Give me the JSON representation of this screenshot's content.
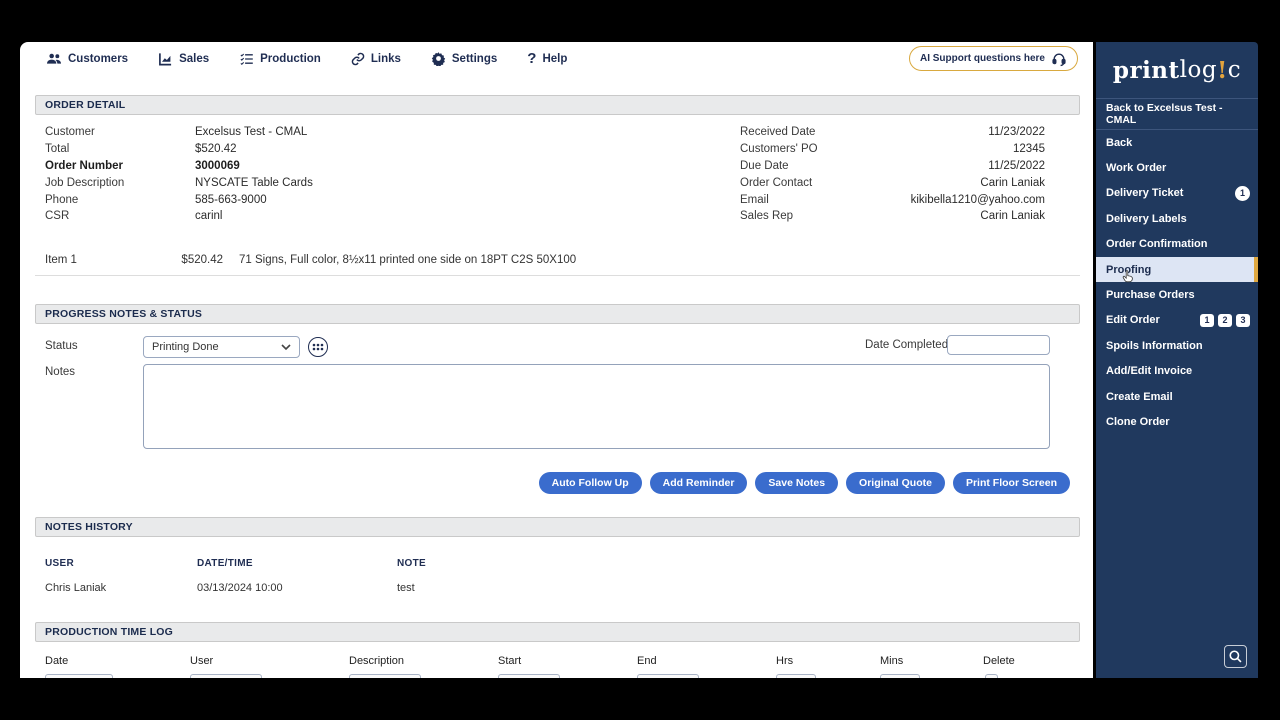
{
  "nav": {
    "items": [
      {
        "label": "Customers",
        "icon": "customers-icon"
      },
      {
        "label": "Sales",
        "icon": "sales-icon"
      },
      {
        "label": "Production",
        "icon": "production-icon"
      },
      {
        "label": "Links",
        "icon": "links-icon"
      },
      {
        "label": "Settings",
        "icon": "settings-icon"
      },
      {
        "label": "Help",
        "icon": "help-icon"
      }
    ],
    "ai_support_label": "AI Support questions here"
  },
  "order_detail": {
    "title": "ORDER DETAIL",
    "left": [
      {
        "label": "Customer",
        "value": "Excelsus Test - CMAL"
      },
      {
        "label": "Total",
        "value": "$520.42"
      },
      {
        "label": "Order Number",
        "value": "3000069"
      },
      {
        "label": "Job Description",
        "value": "NYSCATE Table Cards"
      },
      {
        "label": "Phone",
        "value": "585-663-9000"
      },
      {
        "label": "CSR",
        "value": "carinl"
      }
    ],
    "right": [
      {
        "label": "Received Date",
        "value": "11/23/2022"
      },
      {
        "label": "Customers' PO",
        "value": "12345"
      },
      {
        "label": "Due Date",
        "value": "11/25/2022"
      },
      {
        "label": "Order Contact",
        "value": "Carin Laniak"
      },
      {
        "label": "Email",
        "value": "kikibella1210@yahoo.com"
      },
      {
        "label": "Sales Rep",
        "value": "Carin Laniak"
      }
    ],
    "item": {
      "name": "Item 1",
      "price": "$520.42",
      "description": "71 Signs, Full color, 8½x11 printed one side on 18PT C2S 50X100"
    }
  },
  "progress": {
    "title": "PROGRESS NOTES & STATUS",
    "status_label": "Status",
    "status_value": "Printing Done",
    "date_completed_label": "Date Completed",
    "notes_label": "Notes",
    "buttons": [
      "Auto Follow Up",
      "Add Reminder",
      "Save Notes",
      "Original Quote",
      "Print Floor Screen"
    ]
  },
  "notes_history": {
    "title": "NOTES HISTORY",
    "headers": [
      "USER",
      "DATE/TIME",
      "NOTE"
    ],
    "rows": [
      {
        "user": "Chris Laniak",
        "datetime": "03/13/2024 10:00",
        "note": "test"
      }
    ]
  },
  "time_log": {
    "title": "PRODUCTION TIME LOG",
    "headers": [
      "Date",
      "User",
      "Description",
      "Start",
      "End",
      "Hrs",
      "Mins",
      "Delete"
    ]
  },
  "sidebar": {
    "logo": {
      "print": "print",
      "log": "log",
      "bang": "!",
      "c": "c"
    },
    "back_link": "Back to Excelsus Test - CMAL",
    "items": [
      {
        "label": "Back"
      },
      {
        "label": "Work Order"
      },
      {
        "label": "Delivery Ticket",
        "badges": [
          "1"
        ]
      },
      {
        "label": "Delivery Labels"
      },
      {
        "label": "Order Confirmation"
      },
      {
        "label": "Proofing",
        "active": true
      },
      {
        "label": "Purchase Orders"
      },
      {
        "label": "Edit Order",
        "badges": [
          "1",
          "2",
          "3"
        ]
      },
      {
        "label": "Spoils Information"
      },
      {
        "label": "Add/Edit Invoice"
      },
      {
        "label": "Create Email"
      },
      {
        "label": "Clone Order"
      }
    ]
  },
  "colors": {
    "sidebar_bg": "#20395e",
    "accent_gold": "#dfa840",
    "button_blue": "#3a6ccd",
    "navy_text": "#1f2d52",
    "active_item_bg": "#dde5f4",
    "section_bar_bg": "#e9eaeb"
  }
}
